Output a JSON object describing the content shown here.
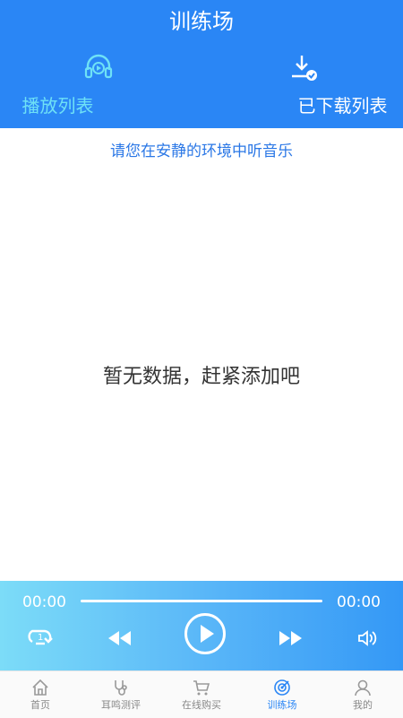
{
  "header": {
    "title": "训练场",
    "tabs": [
      {
        "label": "播放列表",
        "icon": "headphones-play-icon",
        "active": true
      },
      {
        "label": "已下载列表",
        "icon": "download-check-icon",
        "active": false
      }
    ]
  },
  "main": {
    "notice": "请您在安静的环境中听音乐",
    "empty_text": "暂无数据，赶紧添加吧"
  },
  "player": {
    "current_time": "00:00",
    "total_time": "00:00",
    "progress": 0,
    "repeat_count": "1"
  },
  "tabbar": {
    "items": [
      {
        "label": "首页",
        "icon": "home-icon"
      },
      {
        "label": "耳鸣测评",
        "icon": "stethoscope-icon"
      },
      {
        "label": "在线购买",
        "icon": "cart-icon"
      },
      {
        "label": "训练场",
        "icon": "target-icon",
        "active": true
      },
      {
        "label": "我的",
        "icon": "user-icon"
      }
    ]
  },
  "colors": {
    "primary": "#2a86f5",
    "active_tab": "#6ee1f6",
    "notice_text": "#2a77e6"
  }
}
